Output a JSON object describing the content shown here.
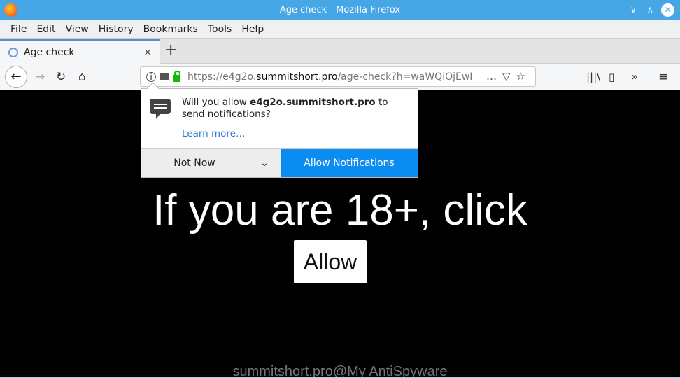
{
  "window": {
    "title": "Age check - Mozilla Firefox"
  },
  "menu": [
    "File",
    "Edit",
    "View",
    "History",
    "Bookmarks",
    "Tools",
    "Help"
  ],
  "tab": {
    "label": "Age check",
    "close": "×",
    "new": "+"
  },
  "url": {
    "prefix": "https://e4g2o.",
    "domain": "summitshort.pro",
    "path": "/age-check?h=waWQiOjEwI"
  },
  "popup": {
    "pre": "Will you allow ",
    "site": "e4g2o.summitshort.pro",
    "post": " to send notifications?",
    "learn": "Learn more…",
    "not_now": "Not Now",
    "allow": "Allow Notifications"
  },
  "page": {
    "headline": "If you are 18+, click",
    "button": "Allow",
    "watermark": "summitshort.pro@My AntiSpyware"
  },
  "colors": {
    "titlebar": "#47a7e6",
    "allow_button": "#0a8cf0"
  }
}
